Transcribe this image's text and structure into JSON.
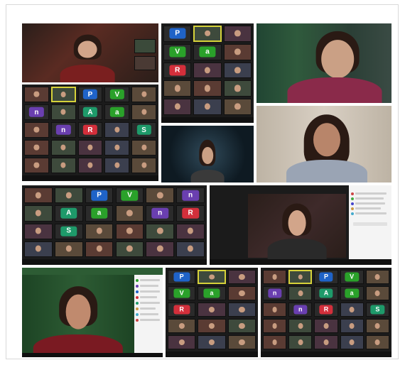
{
  "panels": [
    {
      "id": "p1",
      "tiles": [
        {
          "kind": "photo",
          "bg": "#5a2b22",
          "top": "#3d1d18",
          "shirt": "#7a1f1f"
        },
        {
          "kind": "photo",
          "bg": "#3b4a3a",
          "top": "#1a1a1a",
          "shirt": "#555"
        }
      ]
    },
    {
      "id": "p2",
      "letters": [
        "P",
        "V",
        "a",
        "R"
      ]
    },
    {
      "id": "p3",
      "tiles": [
        {
          "kind": "photo",
          "bg": "#2f5a3c",
          "shirt": "#8a2a4a"
        }
      ]
    },
    {
      "id": "p4",
      "letters": [
        "P",
        "V",
        "n",
        "A",
        "a",
        "n",
        "R",
        "S"
      ]
    },
    {
      "id": "p5",
      "tiles": [
        {
          "kind": "photo",
          "bg": "#1b2a36",
          "shirt": "#3a3a3a"
        }
      ]
    },
    {
      "id": "p6",
      "tiles": [
        {
          "kind": "photo",
          "bg": "#cfc6b8",
          "shirt": "#9aa4b4"
        }
      ]
    },
    {
      "id": "p7",
      "letters": [
        "P",
        "V",
        "n",
        "A",
        "a",
        "n",
        "R",
        "S"
      ]
    },
    {
      "id": "p8",
      "tiles": [
        {
          "kind": "photo",
          "bg": "#3e2a2a",
          "shirt": "#2a2a2a"
        }
      ]
    },
    {
      "id": "p9",
      "tiles": [
        {
          "kind": "photo",
          "bg": "#2d5c34",
          "shirt": "#7a1a22"
        }
      ]
    },
    {
      "id": "p10",
      "letters": [
        "P",
        "V",
        "a",
        "R"
      ]
    },
    {
      "id": "p11",
      "letters": [
        "P",
        "V",
        "n",
        "A",
        "a",
        "n",
        "R",
        "S"
      ]
    }
  ],
  "letter_colors": {
    "P": "#1f63c8",
    "V": "#2aa12a",
    "a": "#2aa12a",
    "n": "#6a3fb0",
    "A": "#1e9a6a",
    "R": "#d32f3b",
    "S": "#1e9a6a"
  }
}
